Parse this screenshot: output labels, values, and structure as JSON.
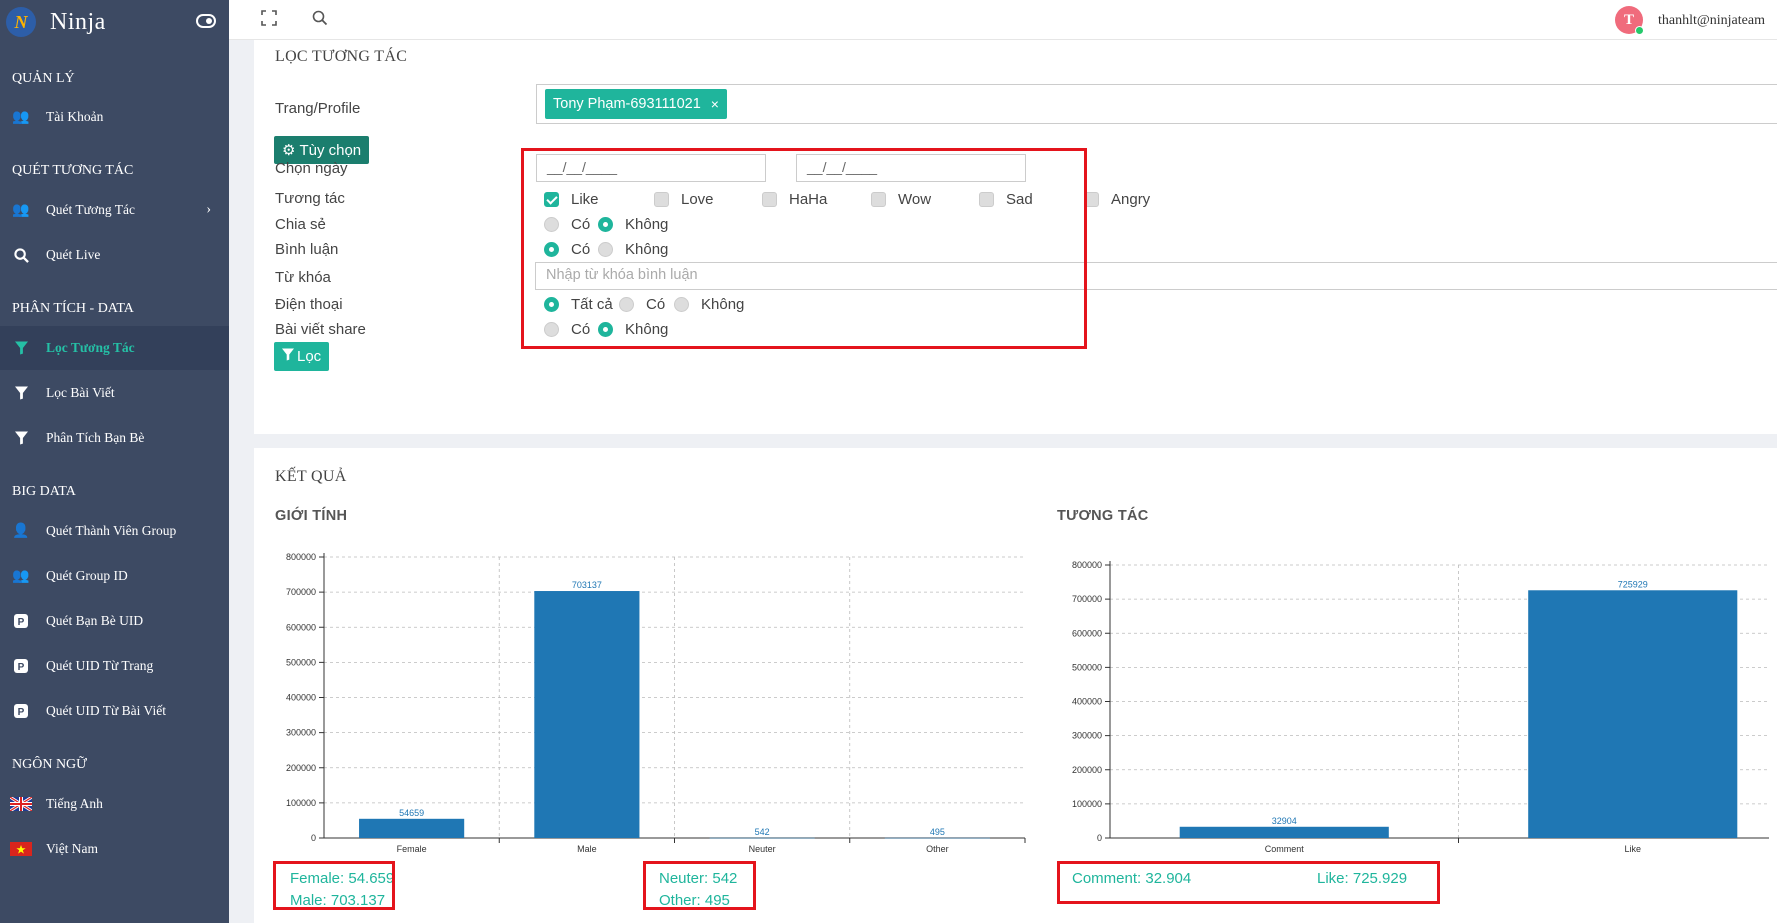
{
  "sidebar": {
    "brand": "Ninja",
    "sections": {
      "quanly": "QUẢN LÝ",
      "quet": "QUÉT TƯƠNG TÁC",
      "phantich": "PHÂN TÍCH - DATA",
      "bigdata": "BIG DATA",
      "ngonngu": "NGÔN NGỮ"
    },
    "items": {
      "taikhoan": "Tài Khoản",
      "quettuongtac": "Quét Tương Tác",
      "quetlive": "Quét Live",
      "loctuongtac": "Lọc Tương Tác",
      "locbaiviet": "Lọc Bài Viết",
      "phantichbanbe": "Phân Tích Bạn Bè",
      "thanhviengroup": "Quét Thành Viên Group",
      "groupid": "Quét Group ID",
      "banbeuid": "Quét Bạn Bè UID",
      "uidtrang": "Quét UID Từ Trang",
      "uidbaiviet": "Quét UID Từ Bài Viết",
      "tienganh": "Tiếng Anh",
      "vietnam": "Việt Nam"
    }
  },
  "topbar": {
    "user_email": "thanhlt@ninjateam",
    "avatar_letter": "T"
  },
  "filter": {
    "title": "LỌC TƯƠNG TÁC",
    "labels": {
      "profile": "Trang/Profile",
      "date": "Chọn ngày",
      "reaction": "Tương tác",
      "share": "Chia sẻ",
      "comment": "Bình luận",
      "keyword": "Từ khóa",
      "phone": "Điện thoại",
      "shared_post": "Bài viết share"
    },
    "profile_tag": "Tony Phạm-693111021",
    "options_button": "Tùy chọn",
    "date_from": "__/__/____",
    "date_to": "__/__/____",
    "reactions": {
      "like": "Like",
      "love": "Love",
      "haha": "HaHa",
      "wow": "Wow",
      "sad": "Sad",
      "angry": "Angry"
    },
    "yes": "Có",
    "no": "Không",
    "all": "Tất cả",
    "keyword_placeholder": "Nhập từ khóa bình luận",
    "filter_button": "Lọc"
  },
  "results": {
    "title": "KẾT QUẢ",
    "gender_title": "GIỚI TÍNH",
    "interaction_title": "TƯƠNG TÁC",
    "gender_summary": {
      "female": "Female: 54.659",
      "male": "Male: 703.137",
      "neuter": "Neuter: 542",
      "other": "Other: 495"
    },
    "interaction_summary": {
      "comment": "Comment: 32.904",
      "like": "Like: 725.929"
    }
  },
  "colors": {
    "bar": "#1f77b4",
    "accent": "#1fb59c",
    "sidebar": "#3d4a63",
    "highlight": "#e4141c"
  },
  "chart_data": [
    {
      "type": "bar",
      "categories": [
        "Female",
        "Male",
        "Neuter",
        "Other"
      ],
      "values": [
        54659,
        703137,
        542,
        495
      ],
      "ylim": [
        0,
        800000
      ],
      "yticks": [
        0,
        100000,
        200000,
        300000,
        400000,
        500000,
        600000,
        700000,
        800000
      ],
      "grid": true
    },
    {
      "type": "bar",
      "categories": [
        "Comment",
        "Like"
      ],
      "values": [
        32904,
        725929
      ],
      "ylim": [
        0,
        800000
      ],
      "yticks": [
        0,
        100000,
        200000,
        300000,
        400000,
        500000,
        600000,
        700000,
        800000
      ],
      "grid": true
    }
  ]
}
